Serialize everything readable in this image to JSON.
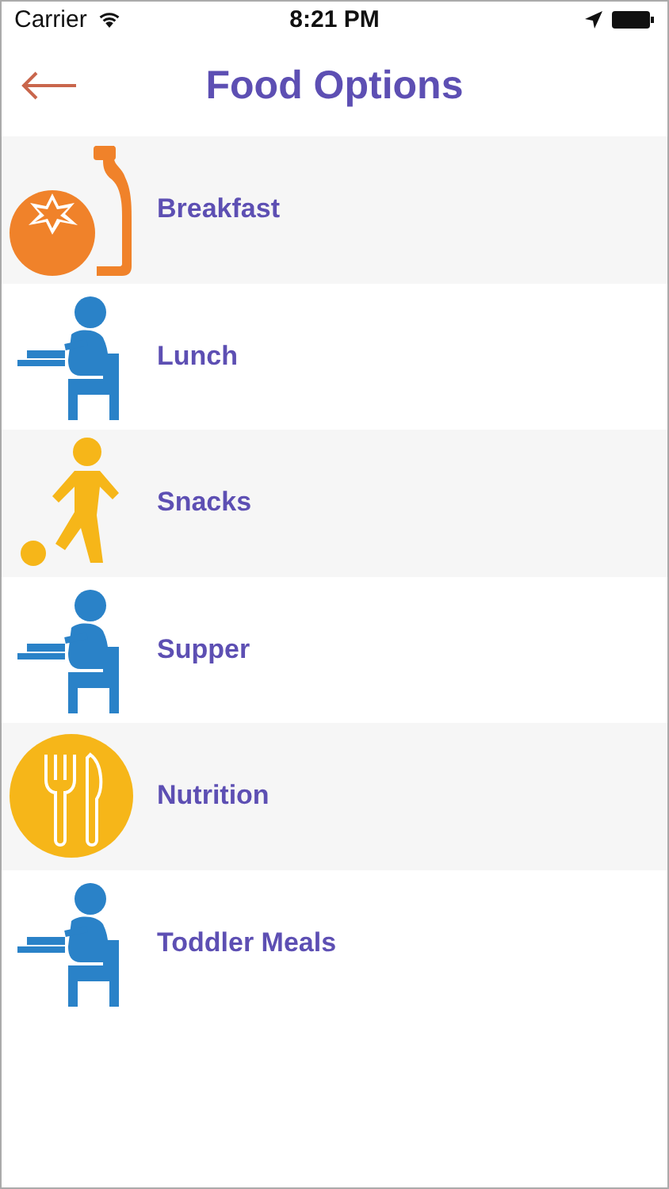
{
  "status_bar": {
    "carrier": "Carrier",
    "time": "8:21 PM"
  },
  "nav": {
    "title": "Food Options"
  },
  "items": [
    {
      "label": "Breakfast",
      "kind": "produce"
    },
    {
      "label": "Lunch",
      "kind": "eating"
    },
    {
      "label": "Snacks",
      "kind": "playing"
    },
    {
      "label": "Supper",
      "kind": "eating"
    },
    {
      "label": "Nutrition",
      "kind": "cutlery"
    },
    {
      "label": "Toddler Meals",
      "kind": "eating"
    }
  ]
}
